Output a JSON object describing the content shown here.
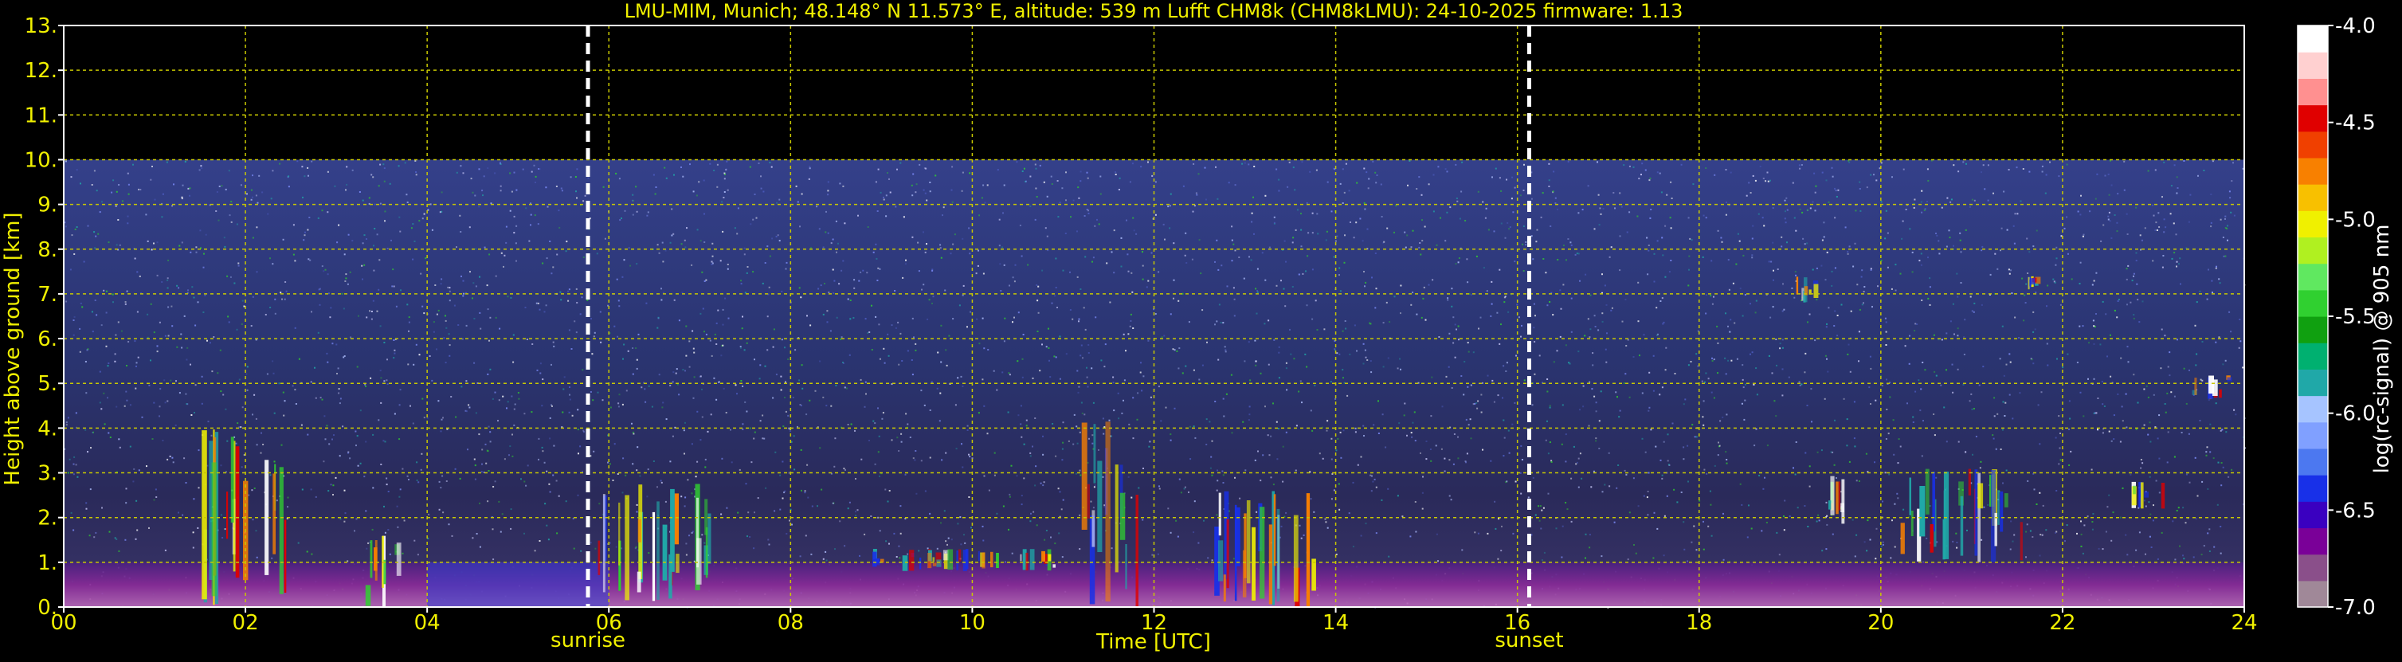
{
  "chart_data": {
    "type": "heatmap",
    "title": "LMU-MIM, Munich; 48.148° N 11.573° E, altitude: 539 m    Lufft CHM8k (CHM8kLMU): 24-10-2025    firmware: 1.13",
    "xlabel": "Time [UTC]",
    "ylabel": "Height above ground [km]",
    "x_ticks": [
      "00",
      "02",
      "04",
      "06",
      "08",
      "10",
      "12",
      "14",
      "16",
      "18",
      "20",
      "22",
      "24"
    ],
    "y_ticks": [
      "0.",
      "1.",
      "2.",
      "3.",
      "4.",
      "5.",
      "6.",
      "7.",
      "8.",
      "9.",
      "10.",
      "11.",
      "12.",
      "13."
    ],
    "xlim": [
      0,
      24
    ],
    "ylim": [
      0,
      13
    ],
    "grid": true,
    "grid_color": "#c8c800",
    "text_color": "#f0f000",
    "data_top_km": 10,
    "events": [
      {
        "label": "sunrise",
        "time": 5.77
      },
      {
        "label": "sunset",
        "time": 16.13
      }
    ],
    "colorbar": {
      "label": "log(rc-signal) @ 905 nm",
      "range": [
        -7.0,
        -4.0
      ],
      "ticks": [
        "-4.0",
        "-4.5",
        "-5.0",
        "-5.5",
        "-6.0",
        "-6.5",
        "-7.0"
      ],
      "colors": [
        "#a08898",
        "#8a4f8a",
        "#7a0098",
        "#3a00c0",
        "#1830e8",
        "#4c78f0",
        "#80a0ff",
        "#a6c4ff",
        "#20a8a8",
        "#00b070",
        "#10a010",
        "#30d030",
        "#60e860",
        "#b0f020",
        "#f0f000",
        "#f8c000",
        "#f88000",
        "#f04000",
        "#e00000",
        "#ff9090",
        "#ffd0d0",
        "#ffffff"
      ]
    },
    "cloud_layers": [
      {
        "t0": 1.5,
        "t1": 2.45,
        "h0": 0.0,
        "h1": 4.0
      },
      {
        "t0": 3.3,
        "t1": 3.75,
        "h0": 0.0,
        "h1": 1.6
      },
      {
        "t0": 5.8,
        "t1": 7.1,
        "h0": 0.0,
        "h1": 2.8
      },
      {
        "t0": 8.9,
        "t1": 10.9,
        "h0": 0.8,
        "h1": 1.3
      },
      {
        "t0": 11.1,
        "t1": 11.8,
        "h0": 0.0,
        "h1": 4.2
      },
      {
        "t0": 12.6,
        "t1": 13.8,
        "h0": 0.0,
        "h1": 2.6
      },
      {
        "t0": 19.4,
        "t1": 19.6,
        "h0": 1.8,
        "h1": 3.0
      },
      {
        "t0": 20.2,
        "t1": 21.6,
        "h0": 1.0,
        "h1": 3.1
      },
      {
        "t0": 22.7,
        "t1": 23.1,
        "h0": 2.2,
        "h1": 2.8
      },
      {
        "t0": 19.0,
        "t1": 19.3,
        "h0": 6.8,
        "h1": 7.4
      },
      {
        "t0": 21.6,
        "t1": 21.7,
        "h0": 7.1,
        "h1": 7.4
      },
      {
        "t0": 23.4,
        "t1": 23.9,
        "h0": 4.6,
        "h1": 5.2
      }
    ]
  }
}
